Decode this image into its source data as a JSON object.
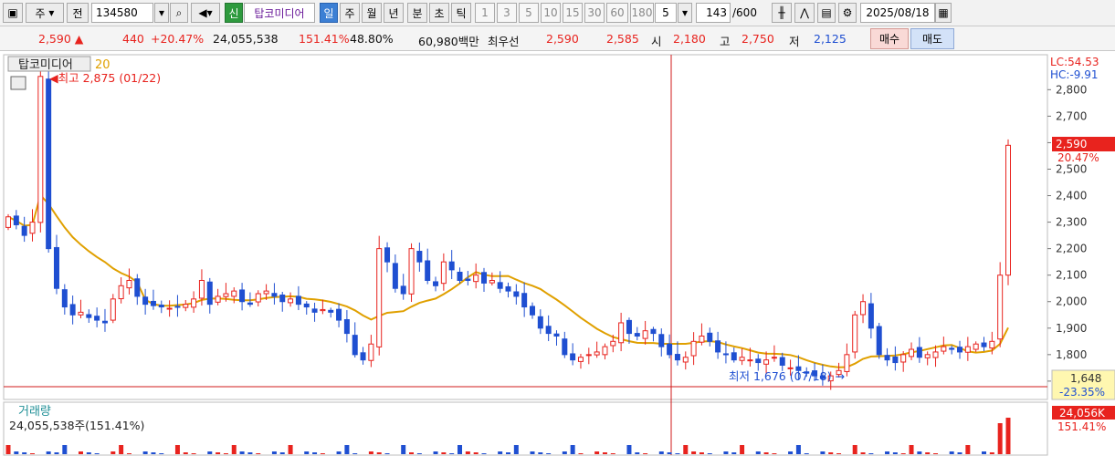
{
  "toolbar": {
    "mode": "주",
    "tab_label": "전",
    "code": "134580",
    "new_badge": "신",
    "name": "탑코미디어",
    "period_daily": "일",
    "period_weekly": "주",
    "period_monthly": "월",
    "period_yearly": "년",
    "period_minute": "분",
    "period_second": "초",
    "period_tick": "틱",
    "intervals": [
      "1",
      "3",
      "5",
      "10",
      "15",
      "30",
      "60",
      "180"
    ],
    "interval_value": "5",
    "count": "143",
    "count_total": "/600",
    "date": "2025/08/18"
  },
  "info": {
    "price": "2,590 ▲",
    "change": "440",
    "change_pct": "+20.47%",
    "volume": "24,055,538",
    "volume_ratio": "151.41%",
    "turnover": "48.80%",
    "amount": "60,980백만",
    "best_label": "최우선",
    "best_ask": "2,590",
    "best_bid": "2,585",
    "open_label": "시",
    "open": "2,180",
    "high_label": "고",
    "high": "2,750",
    "low_label": "저",
    "low": "2,125",
    "sell_button": "매수",
    "buy_button": "매도"
  },
  "chart_data": {
    "type": "candlestick",
    "title": "탑코미디어",
    "ma_label": "20",
    "ylim": [
      1648,
      2925
    ],
    "yticks": [
      1700,
      1800,
      1900,
      2000,
      2100,
      2200,
      2300,
      2400,
      2500,
      2600,
      2700,
      2800
    ],
    "ytick_labels": [
      "1,700",
      "1,800",
      "1,900",
      "2,000",
      "2,100",
      "2,200",
      "2,300",
      "2,400",
      "2,500",
      "2,600",
      "2,700",
      "2,800"
    ],
    "lc_label": "LC:54.53",
    "hc_label": "HC:-9.91",
    "current_price_label": "2,590",
    "current_pct_label": "20.47%",
    "bottom_price_label": "1,648",
    "bottom_pct_label": "-23.35%",
    "high_annotation": "최고 2,875 (01/22)",
    "low_annotation": "최저 1,676 (07/18)",
    "volume_title": "거래량",
    "volume_text": "24,055,538주(151.41%)",
    "volume_right_label": "24,056K",
    "volume_right_pct": "151.41%",
    "colors": {
      "up": "#e8231e",
      "down": "#1f4fd1",
      "ma": "#e0a000",
      "cursor": "#d21b1b"
    }
  }
}
